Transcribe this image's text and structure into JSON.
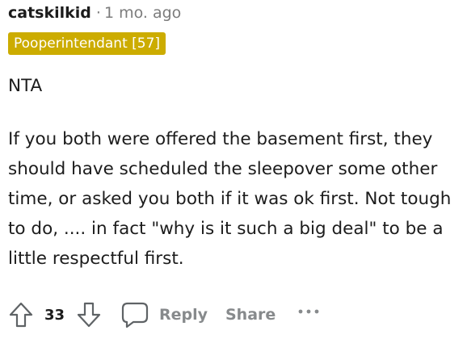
{
  "comment": {
    "author": "catskilkid",
    "separator": "·",
    "time": "1 mo. ago",
    "flair": "Pooperintendant [57]",
    "paragraphs": [
      "NTA",
      "If you both were offered the basement first, they should have scheduled the sleepover some other time, or asked you both if it was ok first. Not tough to do, .... in fact \"why is it such a big deal\" to be a little respectful first."
    ],
    "score": "33",
    "actions": {
      "reply": "Reply",
      "share": "Share",
      "more": "···"
    },
    "icons": {
      "upvote": "upvote-arrow-icon",
      "downvote": "downvote-arrow-icon",
      "reply": "speech-bubble-icon",
      "more": "ellipsis-icon"
    },
    "colors": {
      "flair_bg": "#ccac00",
      "muted": "#878a8c",
      "text": "#1c1c1c"
    }
  }
}
